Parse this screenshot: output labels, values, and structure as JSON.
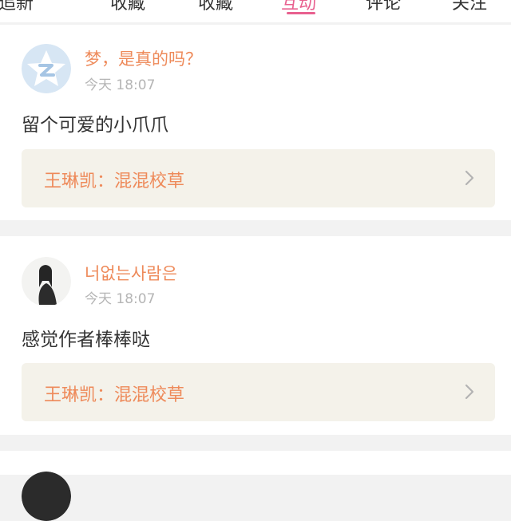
{
  "tabs": [
    {
      "label": "追新"
    },
    {
      "label": "收藏"
    },
    {
      "label": "收藏"
    },
    {
      "label": "互动"
    },
    {
      "label": "评论"
    },
    {
      "label": "关注"
    }
  ],
  "colors": {
    "accent": "#e8608f",
    "username": "#ee8a5a",
    "reference_bg": "#f4f2ea"
  },
  "comments": [
    {
      "avatar_icon": "qzone-default-avatar-icon",
      "username": "梦，是真的吗？",
      "time": "今天 18:07",
      "text": "留个可爱的小爪爪",
      "reference": "王琳凯：混混校草",
      "chevron_icon": "chevron-right-icon"
    },
    {
      "avatar_icon": "user-photo-avatar",
      "username": "너없는사람은",
      "time": "今天 18:07",
      "text": "感觉作者棒棒哒",
      "reference": "王琳凯：混混校草",
      "chevron_icon": "chevron-right-icon"
    }
  ]
}
